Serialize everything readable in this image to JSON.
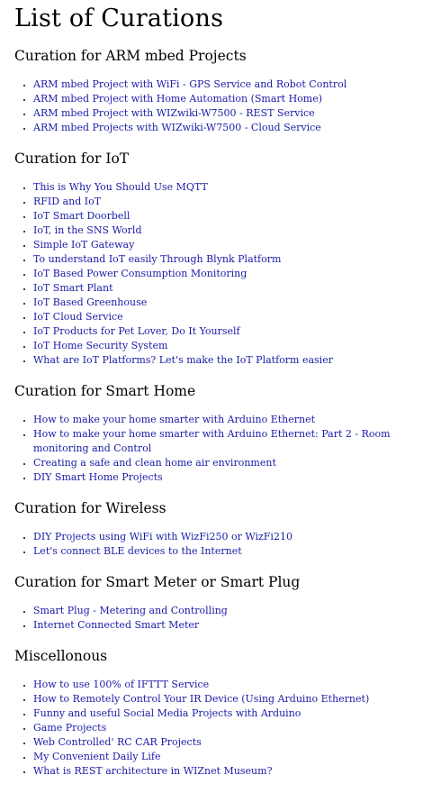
{
  "page_title": "List of Curations",
  "sections": [
    {
      "heading": "Curation for ARM mbed Projects",
      "links": [
        "ARM mbed Project with WiFi - GPS Service and Robot Control",
        "ARM mbed Project with Home Automation (Smart Home)",
        "ARM mbed Project with WIZwiki-W7500 - REST Service",
        "ARM mbed Projects with WIZwiki-W7500 - Cloud Service"
      ]
    },
    {
      "heading": "Curation for IoT",
      "links": [
        "This is Why You Should Use MQTT",
        "RFID and IoT",
        "IoT Smart Doorbell",
        "IoT, in the SNS World",
        "Simple IoT Gateway",
        "To understand IoT easily Through Blynk Platform",
        "IoT Based Power Consumption Monitoring",
        "IoT Smart Plant",
        "IoT Based Greenhouse",
        "IoT Cloud Service",
        "IoT Products for Pet Lover, Do It Yourself",
        "IoT Home Security System",
        "What are IoT Platforms? Let's make the IoT Platform easier"
      ]
    },
    {
      "heading": "Curation for Smart Home",
      "links": [
        "How to make your home smarter with Arduino Ethernet",
        "How to make your home smarter with Arduino Ethernet: Part 2 - Room monitoring and Control",
        "Creating a safe and clean home air environment",
        "DIY Smart Home Projects"
      ]
    },
    {
      "heading": "Curation for Wireless",
      "links": [
        "DIY Projects using WiFi with WizFi250 or WizFi210",
        "Let's connect BLE devices to the Internet"
      ]
    },
    {
      "heading": "Curation for Smart Meter or Smart Plug",
      "links": [
        "Smart Plug - Metering and Controlling",
        "Internet Connected Smart Meter"
      ]
    },
    {
      "heading": "Miscellonous",
      "links": [
        "How to use 100% of IFTTT Service",
        "How to Remotely Control Your IR Device (Using Arduino Ethernet)",
        "Funny and useful Social Media Projects with Arduino",
        "Game Projects",
        "Web Controlled' RC CAR Projects",
        "My Convenient Daily Life",
        "What is REST architecture in WIZnet Museum?"
      ]
    }
  ]
}
